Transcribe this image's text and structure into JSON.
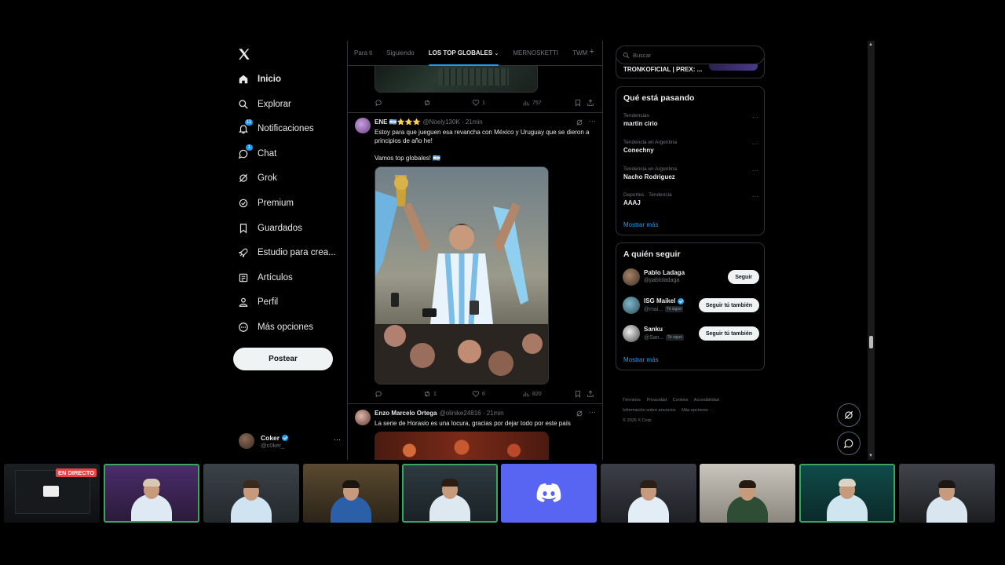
{
  "nav": {
    "items": [
      {
        "label": "Inicio",
        "icon": "home-icon"
      },
      {
        "label": "Explorar",
        "icon": "search-icon"
      },
      {
        "label": "Notificaciones",
        "icon": "bell-icon",
        "badge": "11"
      },
      {
        "label": "Chat",
        "icon": "chat-icon",
        "badge": "1"
      },
      {
        "label": "Grok",
        "icon": "grok-icon"
      },
      {
        "label": "Premium",
        "icon": "premium-icon"
      },
      {
        "label": "Guardados",
        "icon": "bookmark-icon"
      },
      {
        "label": "Estudio para crea...",
        "icon": "rocket-icon"
      },
      {
        "label": "Artículos",
        "icon": "article-icon"
      },
      {
        "label": "Perfil",
        "icon": "profile-icon"
      },
      {
        "label": "Más opciones",
        "icon": "more-icon"
      }
    ],
    "post_label": "Postear",
    "account": {
      "name": "Coker",
      "handle": "@c0ker_"
    }
  },
  "tabs": [
    "Para ti",
    "Siguiendo",
    "LOS TOP GLOBALES",
    "MERNOSKETTI",
    "TWM"
  ],
  "prev_tweet": {
    "replies": "",
    "reposts": "",
    "likes": "1",
    "views": "757"
  },
  "tweet1": {
    "name": "ENE 🇦🇷⭐⭐⭐",
    "meta": "@Noely130K · 21min",
    "line1": "Estoy para que jueguen esa revancha con México y Uruguay que se dieron a",
    "line2": "principios de año he!",
    "line3": "Vamos top globales! 🇦🇷",
    "replies": "",
    "reposts": "1",
    "likes": "6",
    "views": "820"
  },
  "tweet2": {
    "name": "Enzo Marcelo Ortega",
    "meta": "@olinike24816 · 21min",
    "text": "La serie de Horasio es una locura, gracias por dejar todo por este país"
  },
  "search": {
    "placeholder": "Buscar"
  },
  "top_card": {
    "text": "TRONKOFICIAL | PREX: ..."
  },
  "trending": {
    "title": "Qué está pasando",
    "items": [
      {
        "context": "Tendencias",
        "title": "martin cirio"
      },
      {
        "context": "Tendencia en Argentina",
        "title": "Conechny"
      },
      {
        "context": "Tendencia en Argentina",
        "title": "Nacho Rodriguez"
      },
      {
        "context": "Deportes · Tendencia",
        "title": "AAAJ"
      }
    ],
    "show_more": "Mostrar más"
  },
  "who_to_follow": {
    "title": "A quién seguir",
    "users": [
      {
        "name": "Pablo Ladaga",
        "handle": "@pabloladaga",
        "button": "Seguir",
        "follows_you": ""
      },
      {
        "name": "ISG Maikel",
        "handle": "@mai...",
        "button": "Seguir tú también",
        "follows_you": "Te sigue"
      },
      {
        "name": "Sanku",
        "handle": "@San...",
        "button": "Seguir tú también",
        "follows_you": "Te sigue"
      }
    ],
    "show_more": "Mostrar más"
  },
  "footer": {
    "links": [
      "Términos",
      "Privacidad",
      "Cookies",
      "Accesibilidad",
      "Información sobre anuncios",
      "Más opciones ···"
    ],
    "copyright": "© 2026 X Corp."
  },
  "stream": {
    "live_label": "EN DIRECTO"
  },
  "colors": {
    "accent": "#1d9bf0",
    "background": "#000000",
    "border": "#2f3336",
    "muted": "#71767b",
    "discord": "#5865f2",
    "live": "#ed4245"
  }
}
